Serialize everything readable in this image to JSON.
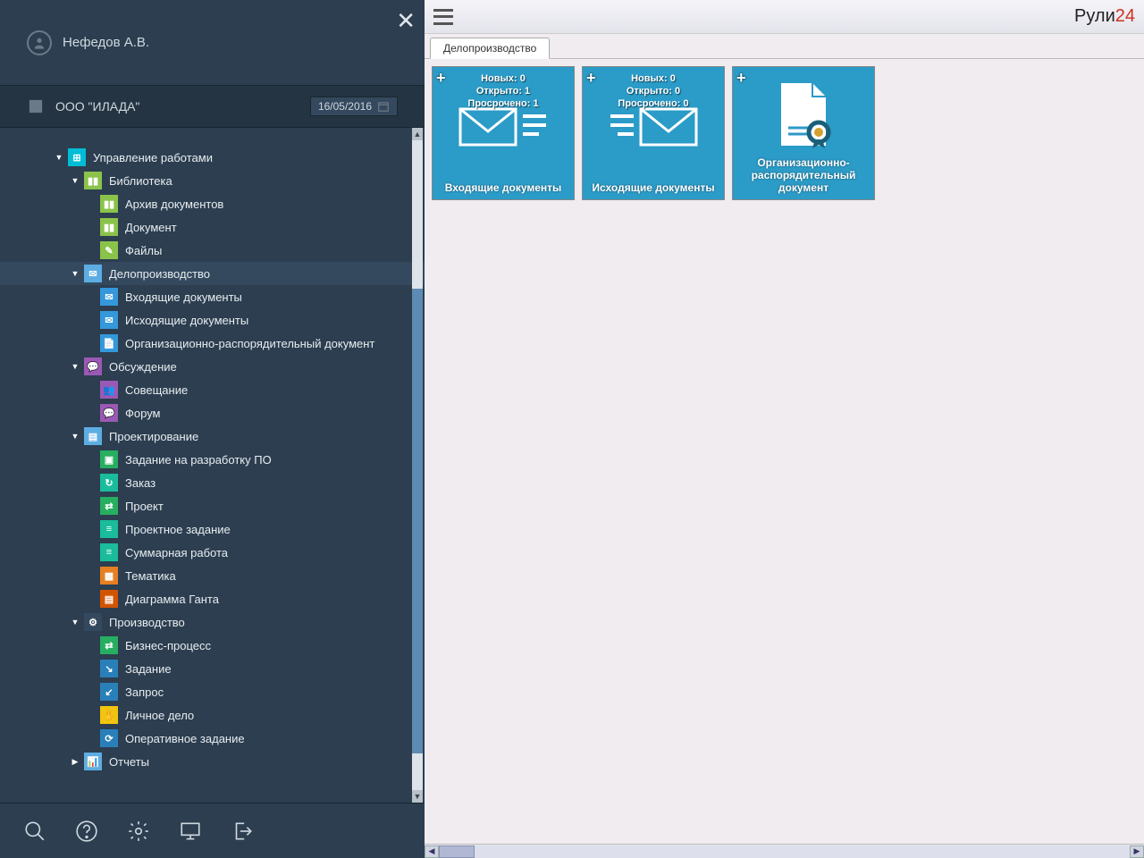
{
  "user": {
    "name": "Нефедов А.В."
  },
  "org": {
    "name": "ООО \"ИЛАДА\"",
    "date": "16/05/2016"
  },
  "brand": {
    "part1": "Рули",
    "part2": "24"
  },
  "tab": {
    "label": "Делопроизводство"
  },
  "tree": [
    {
      "level": 0,
      "exp": "expanded",
      "icon": "ic-cyan",
      "glyph": "⊞",
      "label": "Управление работами"
    },
    {
      "level": 1,
      "exp": "expanded",
      "icon": "ic-lime",
      "glyph": "▮▮",
      "label": "Библиотека"
    },
    {
      "level": 2,
      "exp": "",
      "icon": "ic-lime",
      "glyph": "▮▮",
      "label": "Архив документов"
    },
    {
      "level": 2,
      "exp": "",
      "icon": "ic-lime",
      "glyph": "▮▮",
      "label": "Документ"
    },
    {
      "level": 2,
      "exp": "",
      "icon": "ic-lime",
      "glyph": "✎",
      "label": "Файлы"
    },
    {
      "level": 1,
      "exp": "expanded",
      "icon": "ic-lblue",
      "glyph": "✉",
      "label": "Делопроизводство",
      "selected": true
    },
    {
      "level": 2,
      "exp": "",
      "icon": "ic-blue",
      "glyph": "✉",
      "label": "Входящие документы"
    },
    {
      "level": 2,
      "exp": "",
      "icon": "ic-blue",
      "glyph": "✉",
      "label": "Исходящие документы"
    },
    {
      "level": 2,
      "exp": "",
      "icon": "ic-blue",
      "glyph": "📄",
      "label": "Организационно-распорядительный документ"
    },
    {
      "level": 1,
      "exp": "expanded",
      "icon": "ic-purple",
      "glyph": "💬",
      "label": "Обсуждение"
    },
    {
      "level": 2,
      "exp": "",
      "icon": "ic-purple",
      "glyph": "👥",
      "label": "Совещание"
    },
    {
      "level": 2,
      "exp": "",
      "icon": "ic-purple",
      "glyph": "💬",
      "label": "Форум"
    },
    {
      "level": 1,
      "exp": "expanded",
      "icon": "ic-lblue",
      "glyph": "▤",
      "label": "Проектирование"
    },
    {
      "level": 2,
      "exp": "",
      "icon": "ic-green",
      "glyph": "▣",
      "label": "Задание на разработку ПО"
    },
    {
      "level": 2,
      "exp": "",
      "icon": "ic-teal",
      "glyph": "↻",
      "label": "Заказ"
    },
    {
      "level": 2,
      "exp": "",
      "icon": "ic-green",
      "glyph": "⇄",
      "label": "Проект"
    },
    {
      "level": 2,
      "exp": "",
      "icon": "ic-teal",
      "glyph": "≡",
      "label": "Проектное задание"
    },
    {
      "level": 2,
      "exp": "",
      "icon": "ic-teal",
      "glyph": "≡",
      "label": "Суммарная работа"
    },
    {
      "level": 2,
      "exp": "",
      "icon": "ic-orange",
      "glyph": "▦",
      "label": "Тематика"
    },
    {
      "level": 2,
      "exp": "",
      "icon": "ic-dorange",
      "glyph": "▤",
      "label": "Диаграмма Ганта"
    },
    {
      "level": 1,
      "exp": "expanded",
      "icon": "ic-navy",
      "glyph": "⚙",
      "label": "Производство"
    },
    {
      "level": 2,
      "exp": "",
      "icon": "ic-green",
      "glyph": "⇄",
      "label": "Бизнес-процесс"
    },
    {
      "level": 2,
      "exp": "",
      "icon": "ic-dblue",
      "glyph": "↘",
      "label": "Задание"
    },
    {
      "level": 2,
      "exp": "",
      "icon": "ic-dblue",
      "glyph": "↙",
      "label": "Запрос"
    },
    {
      "level": 2,
      "exp": "",
      "icon": "ic-yellow",
      "glyph": "✋",
      "label": "Личное дело"
    },
    {
      "level": 2,
      "exp": "",
      "icon": "ic-dblue",
      "glyph": "⟳",
      "label": "Оперативное задание"
    },
    {
      "level": 1,
      "exp": "collapsed",
      "icon": "ic-lblue",
      "glyph": "📊",
      "label": "Отчеты"
    }
  ],
  "tiles": [
    {
      "label": "Входящие документы",
      "stats": {
        "l1": "Новых: 0",
        "l2": "Открыто: 1",
        "l3": "Просрочено: 1"
      },
      "type": "mail"
    },
    {
      "label": "Исходящие документы",
      "stats": {
        "l1": "Новых: 0",
        "l2": "Открыто: 0",
        "l3": "Просрочено: 0"
      },
      "type": "mail-out"
    },
    {
      "label": "Организационно-распорядительный документ",
      "stats": null,
      "type": "doc"
    }
  ]
}
